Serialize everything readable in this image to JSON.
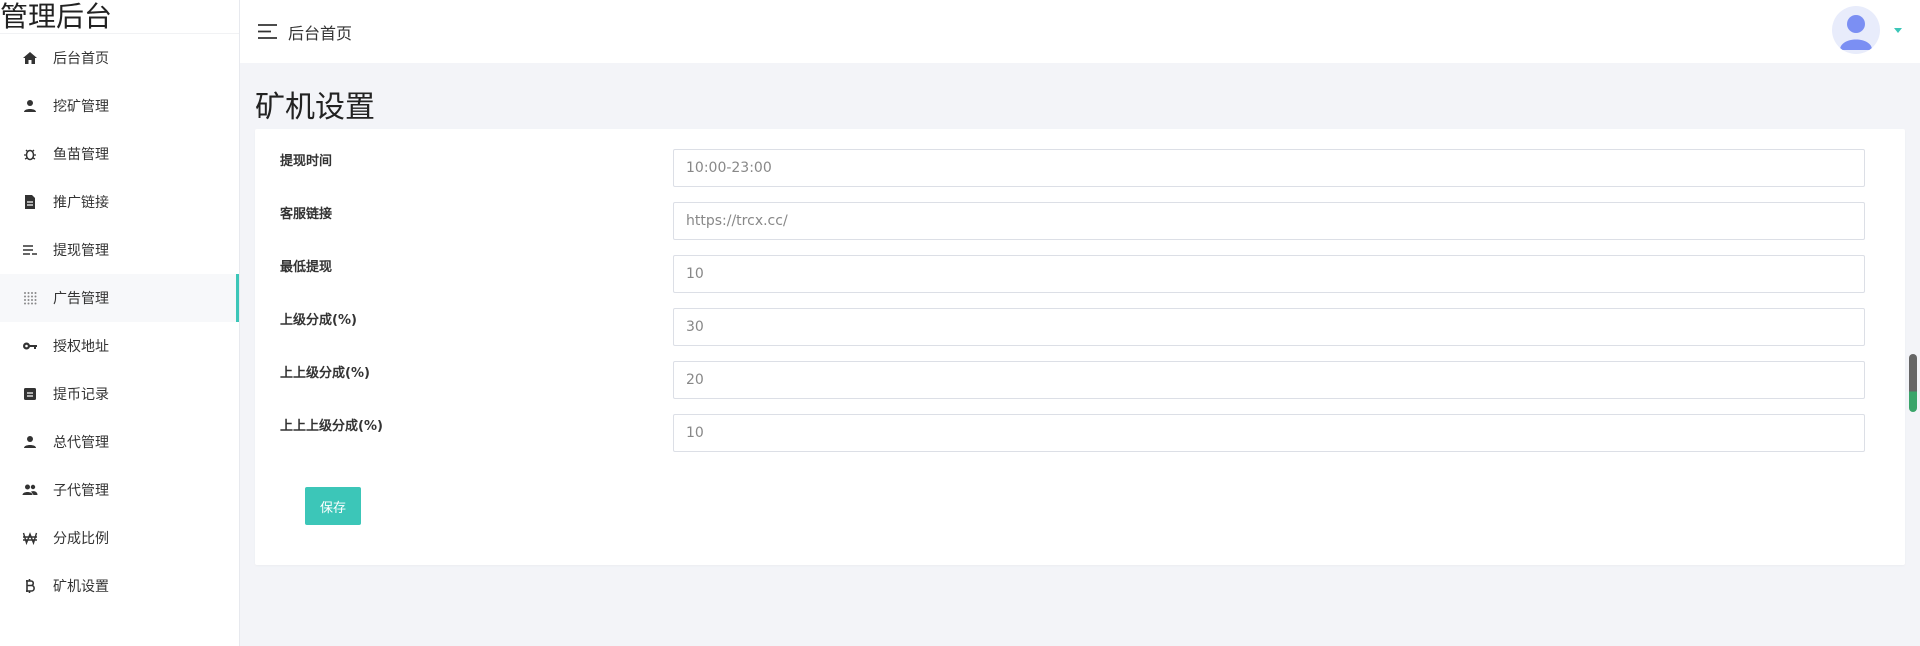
{
  "brand": "管理后台",
  "header": {
    "breadcrumb": "后台首页"
  },
  "sidebar": {
    "items": [
      {
        "label": "后台首页",
        "icon": "home-icon"
      },
      {
        "label": "挖矿管理",
        "icon": "user-icon"
      },
      {
        "label": "鱼苗管理",
        "icon": "bug-icon"
      },
      {
        "label": "推广链接",
        "icon": "document-icon"
      },
      {
        "label": "提现管理",
        "icon": "list-icon"
      },
      {
        "label": "广告管理",
        "icon": "grid-icon"
      },
      {
        "label": "授权地址",
        "icon": "key-icon"
      },
      {
        "label": "提币记录",
        "icon": "record-icon"
      },
      {
        "label": "总代管理",
        "icon": "user-icon"
      },
      {
        "label": "子代管理",
        "icon": "group-icon"
      },
      {
        "label": "分成比例",
        "icon": "won-icon"
      },
      {
        "label": "矿机设置",
        "icon": "bitcoin-icon"
      }
    ],
    "active_index": 5
  },
  "page": {
    "title": "矿机设置"
  },
  "form": {
    "fields": [
      {
        "label": "提现时间",
        "value": "10:00-23:00"
      },
      {
        "label": "客服链接",
        "value": "https://trcx.cc/"
      },
      {
        "label": "最低提现",
        "value": "10"
      },
      {
        "label": "上级分成(%)",
        "value": "30"
      },
      {
        "label": "上上级分成(%)",
        "value": "20"
      },
      {
        "label": "上上上级分成(%)",
        "value": "10"
      }
    ],
    "save_label": "保存"
  },
  "colors": {
    "accent": "#3cc6b8",
    "background": "#f3f4f8"
  }
}
